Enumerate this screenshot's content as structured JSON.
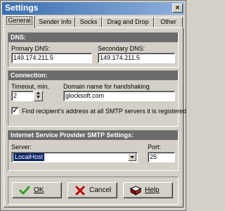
{
  "window": {
    "title": "Settings",
    "close_glyph": "×"
  },
  "tabs": [
    {
      "label": "General",
      "active": true
    },
    {
      "label": "Sender Info",
      "active": false
    },
    {
      "label": "Socks",
      "active": false
    },
    {
      "label": "Drag and Drop",
      "active": false
    },
    {
      "label": "Other",
      "active": false
    }
  ],
  "dns": {
    "header": "DNS:",
    "primary_label": "Primary DNS:",
    "primary_value": "149.174.211.5",
    "secondary_label": "Secondary DNS:",
    "secondary_value": "149.174.211.5"
  },
  "connection": {
    "header": "Connection:",
    "timeout_label": "Timeout, min.",
    "timeout_value": "2",
    "domain_label": "Domain name for handshaking",
    "domain_value": "glocksoft.com",
    "checkbox_checked": true,
    "checkbox_mark": "✓",
    "checkbox_label": "Find recipient's address at all SMTP servers it is registered"
  },
  "isp": {
    "header": "Internet Service Provider SMTP Settings:",
    "server_label": "Server:",
    "server_value": "LocalHost",
    "port_label": "Port:",
    "port_value": "25"
  },
  "buttons": {
    "ok": {
      "label": "OK",
      "icon": "checkmark-icon"
    },
    "cancel": {
      "label": "Cancel",
      "icon": "x-icon"
    },
    "help": {
      "label": "Help",
      "icon": "book-icon"
    }
  },
  "colors": {
    "title_bar_start": "#3b6fb0",
    "title_bar_end": "#8fb0dc",
    "section_header": "#6b6b6b",
    "selection": "#0a246a",
    "ok_icon": "#2e9d2e",
    "cancel_icon": "#c00000",
    "help_icon": "#8b0000"
  }
}
